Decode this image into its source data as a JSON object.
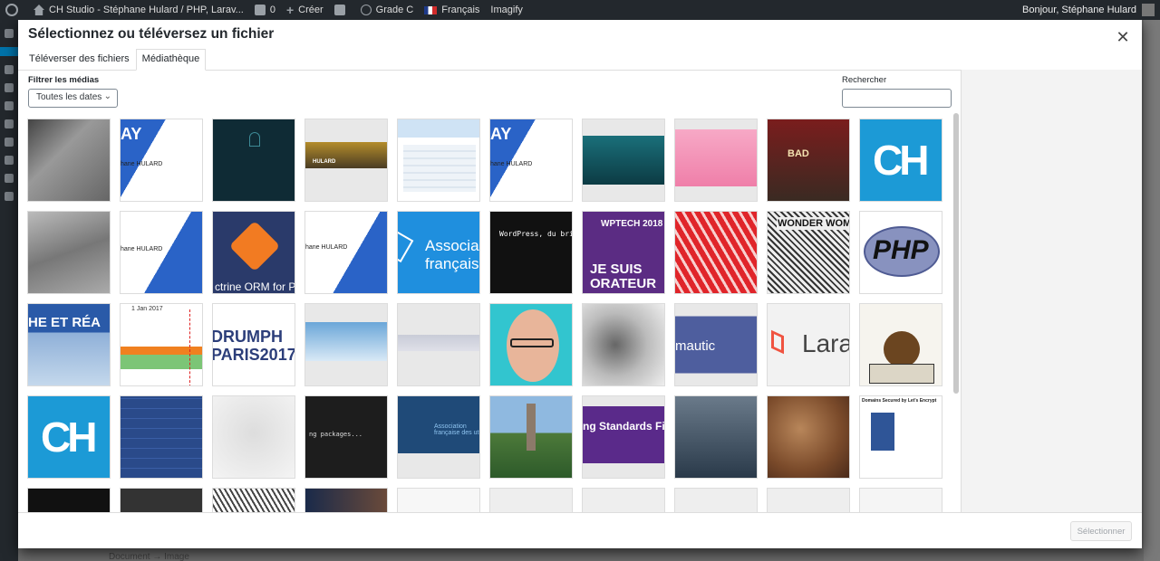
{
  "adminbar": {
    "site_title": "CH Studio - Stéphane Hulard / PHP, Larav...",
    "comments_count": "0",
    "new_label": "Créer",
    "seo_label": "Grade C",
    "language": "Français",
    "imagify": "Imagify",
    "greeting": "Bonjour, Stéphane Hulard"
  },
  "background": {
    "breadcrumb": "Document → Image"
  },
  "modal": {
    "title": "Sélectionnez ou téléversez un fichier",
    "close_icon": "close-icon",
    "tabs": [
      {
        "label": "Téléverser des fichiers",
        "active": false
      },
      {
        "label": "Médiathèque",
        "active": true
      }
    ]
  },
  "filters": {
    "label": "Filtrer les médias",
    "date_select": "Toutes les dates",
    "search_label": "Rechercher",
    "search_value": ""
  },
  "attachments": [
    {
      "row": 1,
      "col": 1,
      "text": ""
    },
    {
      "row": 1,
      "col": 2,
      "text": "hane HULARD"
    },
    {
      "row": 1,
      "col": 3,
      "text": ""
    },
    {
      "row": 1,
      "col": 4,
      "text": "HULARD"
    },
    {
      "row": 1,
      "col": 5,
      "text": ""
    },
    {
      "row": 1,
      "col": 6,
      "text": "hane HULARD"
    },
    {
      "row": 1,
      "col": 7,
      "text": ""
    },
    {
      "row": 1,
      "col": 8,
      "text": ""
    },
    {
      "row": 1,
      "col": 9,
      "text": "BAD"
    },
    {
      "row": 1,
      "col": 10,
      "text": "CH"
    },
    {
      "row": 2,
      "col": 1,
      "text": ""
    },
    {
      "row": 2,
      "col": 2,
      "text": "hane HULARD"
    },
    {
      "row": 2,
      "col": 3,
      "text": "ctrine ORM for P"
    },
    {
      "row": 2,
      "col": 4,
      "text": "hane HULARD"
    },
    {
      "row": 2,
      "col": 5,
      "text": "Associa français"
    },
    {
      "row": 2,
      "col": 6,
      "text": "WordPress, du brico"
    },
    {
      "row": 2,
      "col": 7,
      "text": "WPTECH 2018"
    },
    {
      "row": 2,
      "col": 8,
      "text": ""
    },
    {
      "row": 2,
      "col": 9,
      "text": "WONDER WOMAN"
    },
    {
      "row": 2,
      "col": 10,
      "text": "PHP"
    },
    {
      "row": 3,
      "col": 1,
      "text": "HE ET RÉA"
    },
    {
      "row": 3,
      "col": 2,
      "text": "1 Jan 2017"
    },
    {
      "row": 3,
      "col": 3,
      "text": "DRUMPH PARIS2017"
    },
    {
      "row": 3,
      "col": 4,
      "text": ""
    },
    {
      "row": 3,
      "col": 5,
      "text": ""
    },
    {
      "row": 3,
      "col": 6,
      "text": ""
    },
    {
      "row": 3,
      "col": 7,
      "text": ""
    },
    {
      "row": 3,
      "col": 8,
      "text": "mautic"
    },
    {
      "row": 3,
      "col": 9,
      "text": "Lara"
    },
    {
      "row": 3,
      "col": 10,
      "text": ""
    },
    {
      "row": 4,
      "col": 1,
      "text": "CH"
    },
    {
      "row": 4,
      "col": 2,
      "text": ""
    },
    {
      "row": 4,
      "col": 3,
      "text": ""
    },
    {
      "row": 4,
      "col": 4,
      "text": "ng packages..."
    },
    {
      "row": 4,
      "col": 5,
      "text": "Association française des ut"
    },
    {
      "row": 4,
      "col": 6,
      "text": ""
    },
    {
      "row": 4,
      "col": 7,
      "text": "ng Standards Fix"
    },
    {
      "row": 4,
      "col": 8,
      "text": ""
    },
    {
      "row": 4,
      "col": 9,
      "text": ""
    },
    {
      "row": 4,
      "col": 10,
      "text": "Domains Secured by Let's Encrypt"
    }
  ],
  "footer": {
    "select_button": "Sélectionner"
  },
  "colors": {
    "adminbar": "#23282d",
    "accent": "#0073aa",
    "ch_blue": "#1c9ad6",
    "wptech_purple": "#5b2c83"
  }
}
